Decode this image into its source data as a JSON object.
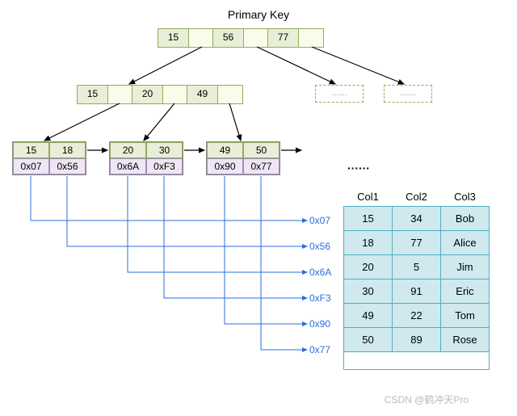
{
  "title": "Primary Key",
  "root": {
    "keys": [
      "15",
      "56",
      "77"
    ]
  },
  "mid": {
    "keys": [
      "15",
      "20",
      "49"
    ]
  },
  "leaves": [
    {
      "keys": [
        "15",
        "18"
      ],
      "ptrs": [
        "0x07",
        "0x56"
      ]
    },
    {
      "keys": [
        "20",
        "30"
      ],
      "ptrs": [
        "0x6A",
        "0xF3"
      ]
    },
    {
      "keys": [
        "49",
        "50"
      ],
      "ptrs": [
        "0x90",
        "0x77"
      ]
    }
  ],
  "ghost_label": "……",
  "ellipsis": "······",
  "pointer_labels": [
    "0x07",
    "0x56",
    "0x6A",
    "0xF3",
    "0x90",
    "0x77"
  ],
  "table": {
    "headers": [
      "Col1",
      "Col2",
      "Col3"
    ],
    "rows": [
      [
        "15",
        "34",
        "Bob"
      ],
      [
        "18",
        "77",
        "Alice"
      ],
      [
        "20",
        "5",
        "Jim"
      ],
      [
        "30",
        "91",
        "Eric"
      ],
      [
        "49",
        "22",
        "Tom"
      ],
      [
        "50",
        "89",
        "Rose"
      ]
    ]
  },
  "watermark": "CSDN @鹤冲天Pro"
}
